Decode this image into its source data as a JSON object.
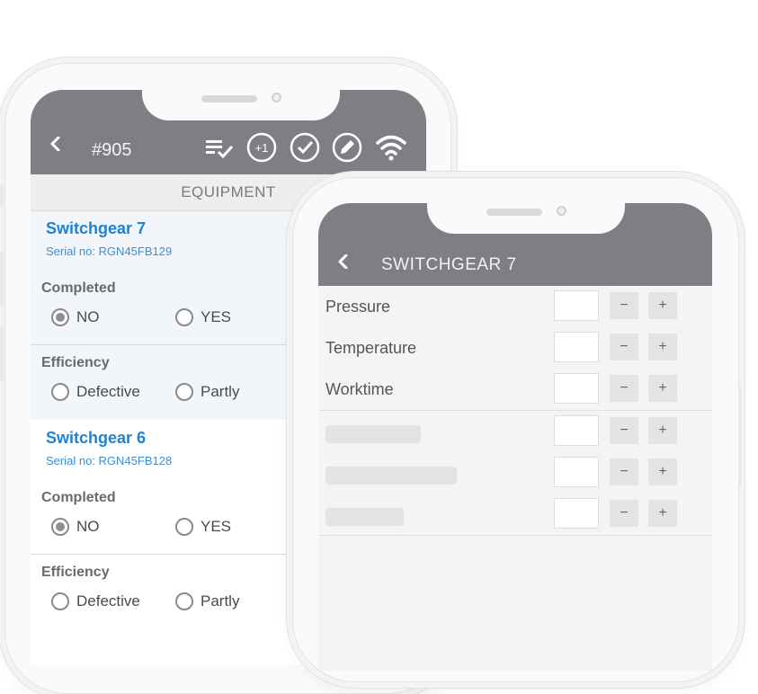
{
  "left_screen": {
    "job_number": "#905",
    "section_header": "EQUIPMENT",
    "toolbar_icons": [
      "checklist-icon",
      "plus-one-icon",
      "check-circle-icon",
      "pencil-circle-icon",
      "wifi-icon"
    ],
    "plus_one_label": "+1",
    "items": [
      {
        "title": "Switchgear 7",
        "serial": "Serial no: RGN45FB129",
        "completed_label": "Completed",
        "completed_options": [
          "NO",
          "YES"
        ],
        "completed_selected": "NO",
        "efficiency_label": "Efficiency",
        "efficiency_options": [
          "Defective",
          "Partly"
        ]
      },
      {
        "title": "Switchgear 6",
        "serial": "Serial no: RGN45FB128",
        "completed_label": "Completed",
        "completed_options": [
          "NO",
          "YES"
        ],
        "completed_selected": "NO",
        "efficiency_label": "Efficiency",
        "efficiency_options": [
          "Defective",
          "Partly"
        ]
      }
    ]
  },
  "right_screen": {
    "title": "SWITCHGEAR 7",
    "minus_label": "−",
    "plus_label": "+",
    "rows": [
      {
        "label": "Pressure"
      },
      {
        "label": "Temperature"
      },
      {
        "label": "Worktime"
      }
    ]
  },
  "colors": {
    "header_bg": "#7e7f84",
    "accent_blue": "#1f82d2"
  }
}
